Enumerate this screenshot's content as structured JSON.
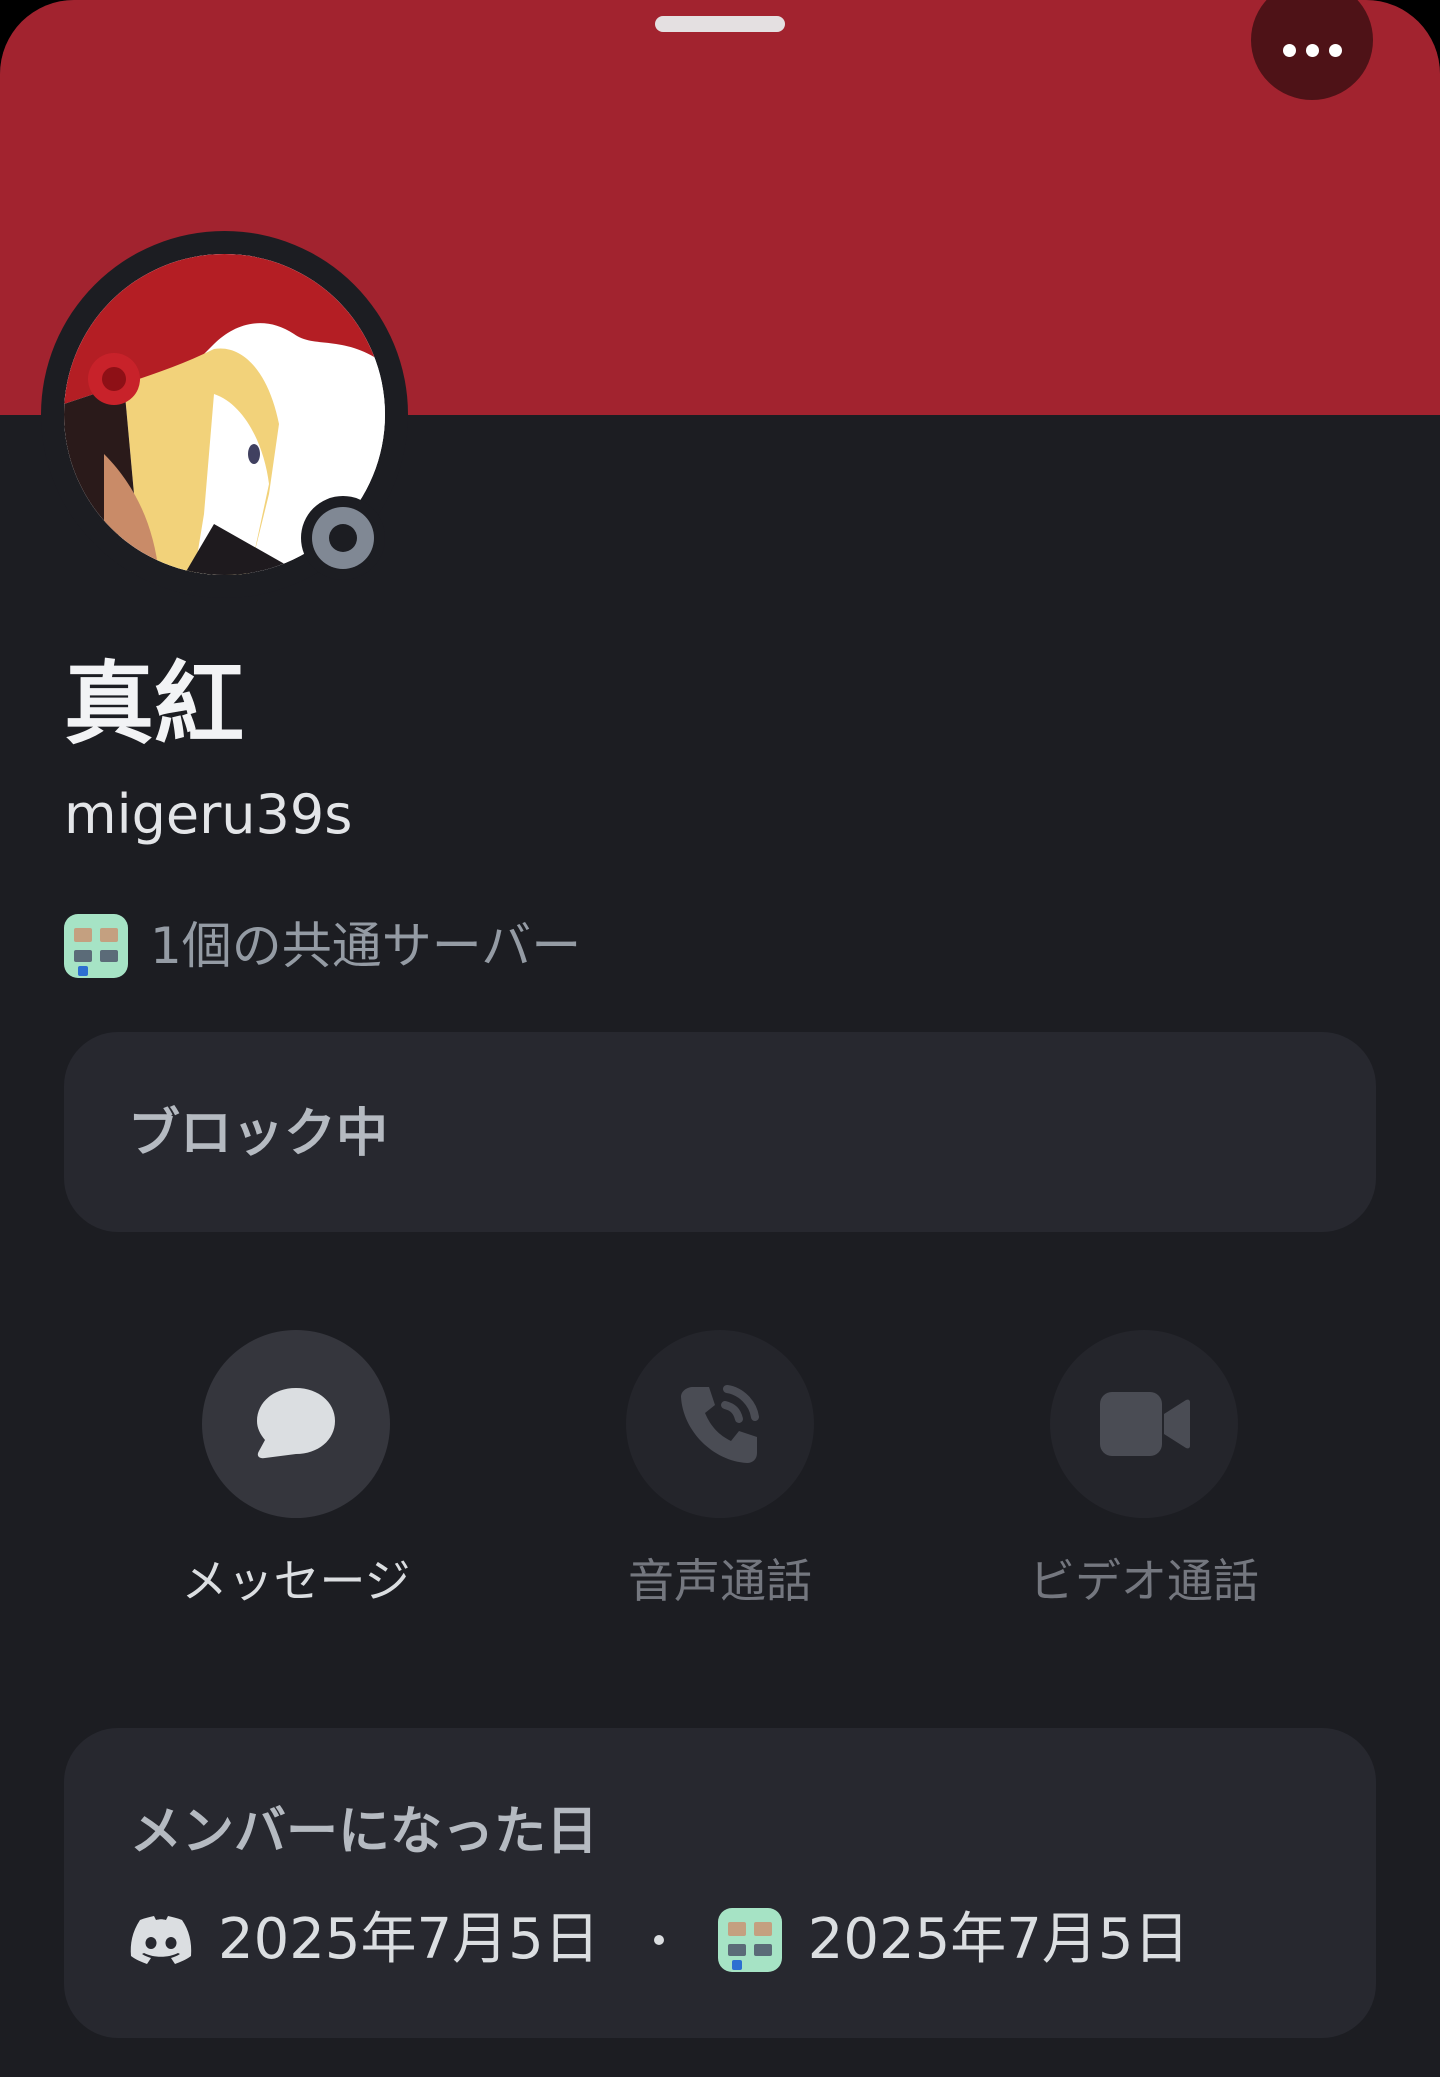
{
  "colors": {
    "banner": "#a2232f",
    "background": "#1c1d22",
    "card": "#27282f",
    "status_offline": "#808894"
  },
  "profile": {
    "display_name": "真紅",
    "username": "migeru39s",
    "status": "offline",
    "mutual_servers": "1個の共通サーバー"
  },
  "relationship": {
    "state_label": "ブロック中"
  },
  "actions": [
    {
      "label": "メッセージ",
      "icon": "chat-bubble-icon",
      "enabled": true
    },
    {
      "label": "音声通話",
      "icon": "phone-icon",
      "enabled": false
    },
    {
      "label": "ビデオ通話",
      "icon": "video-camera-icon",
      "enabled": false
    }
  ],
  "member_since": {
    "title": "メンバーになった日",
    "discord_date": "2025年7月5日",
    "server_date": "2025年7月5日"
  }
}
